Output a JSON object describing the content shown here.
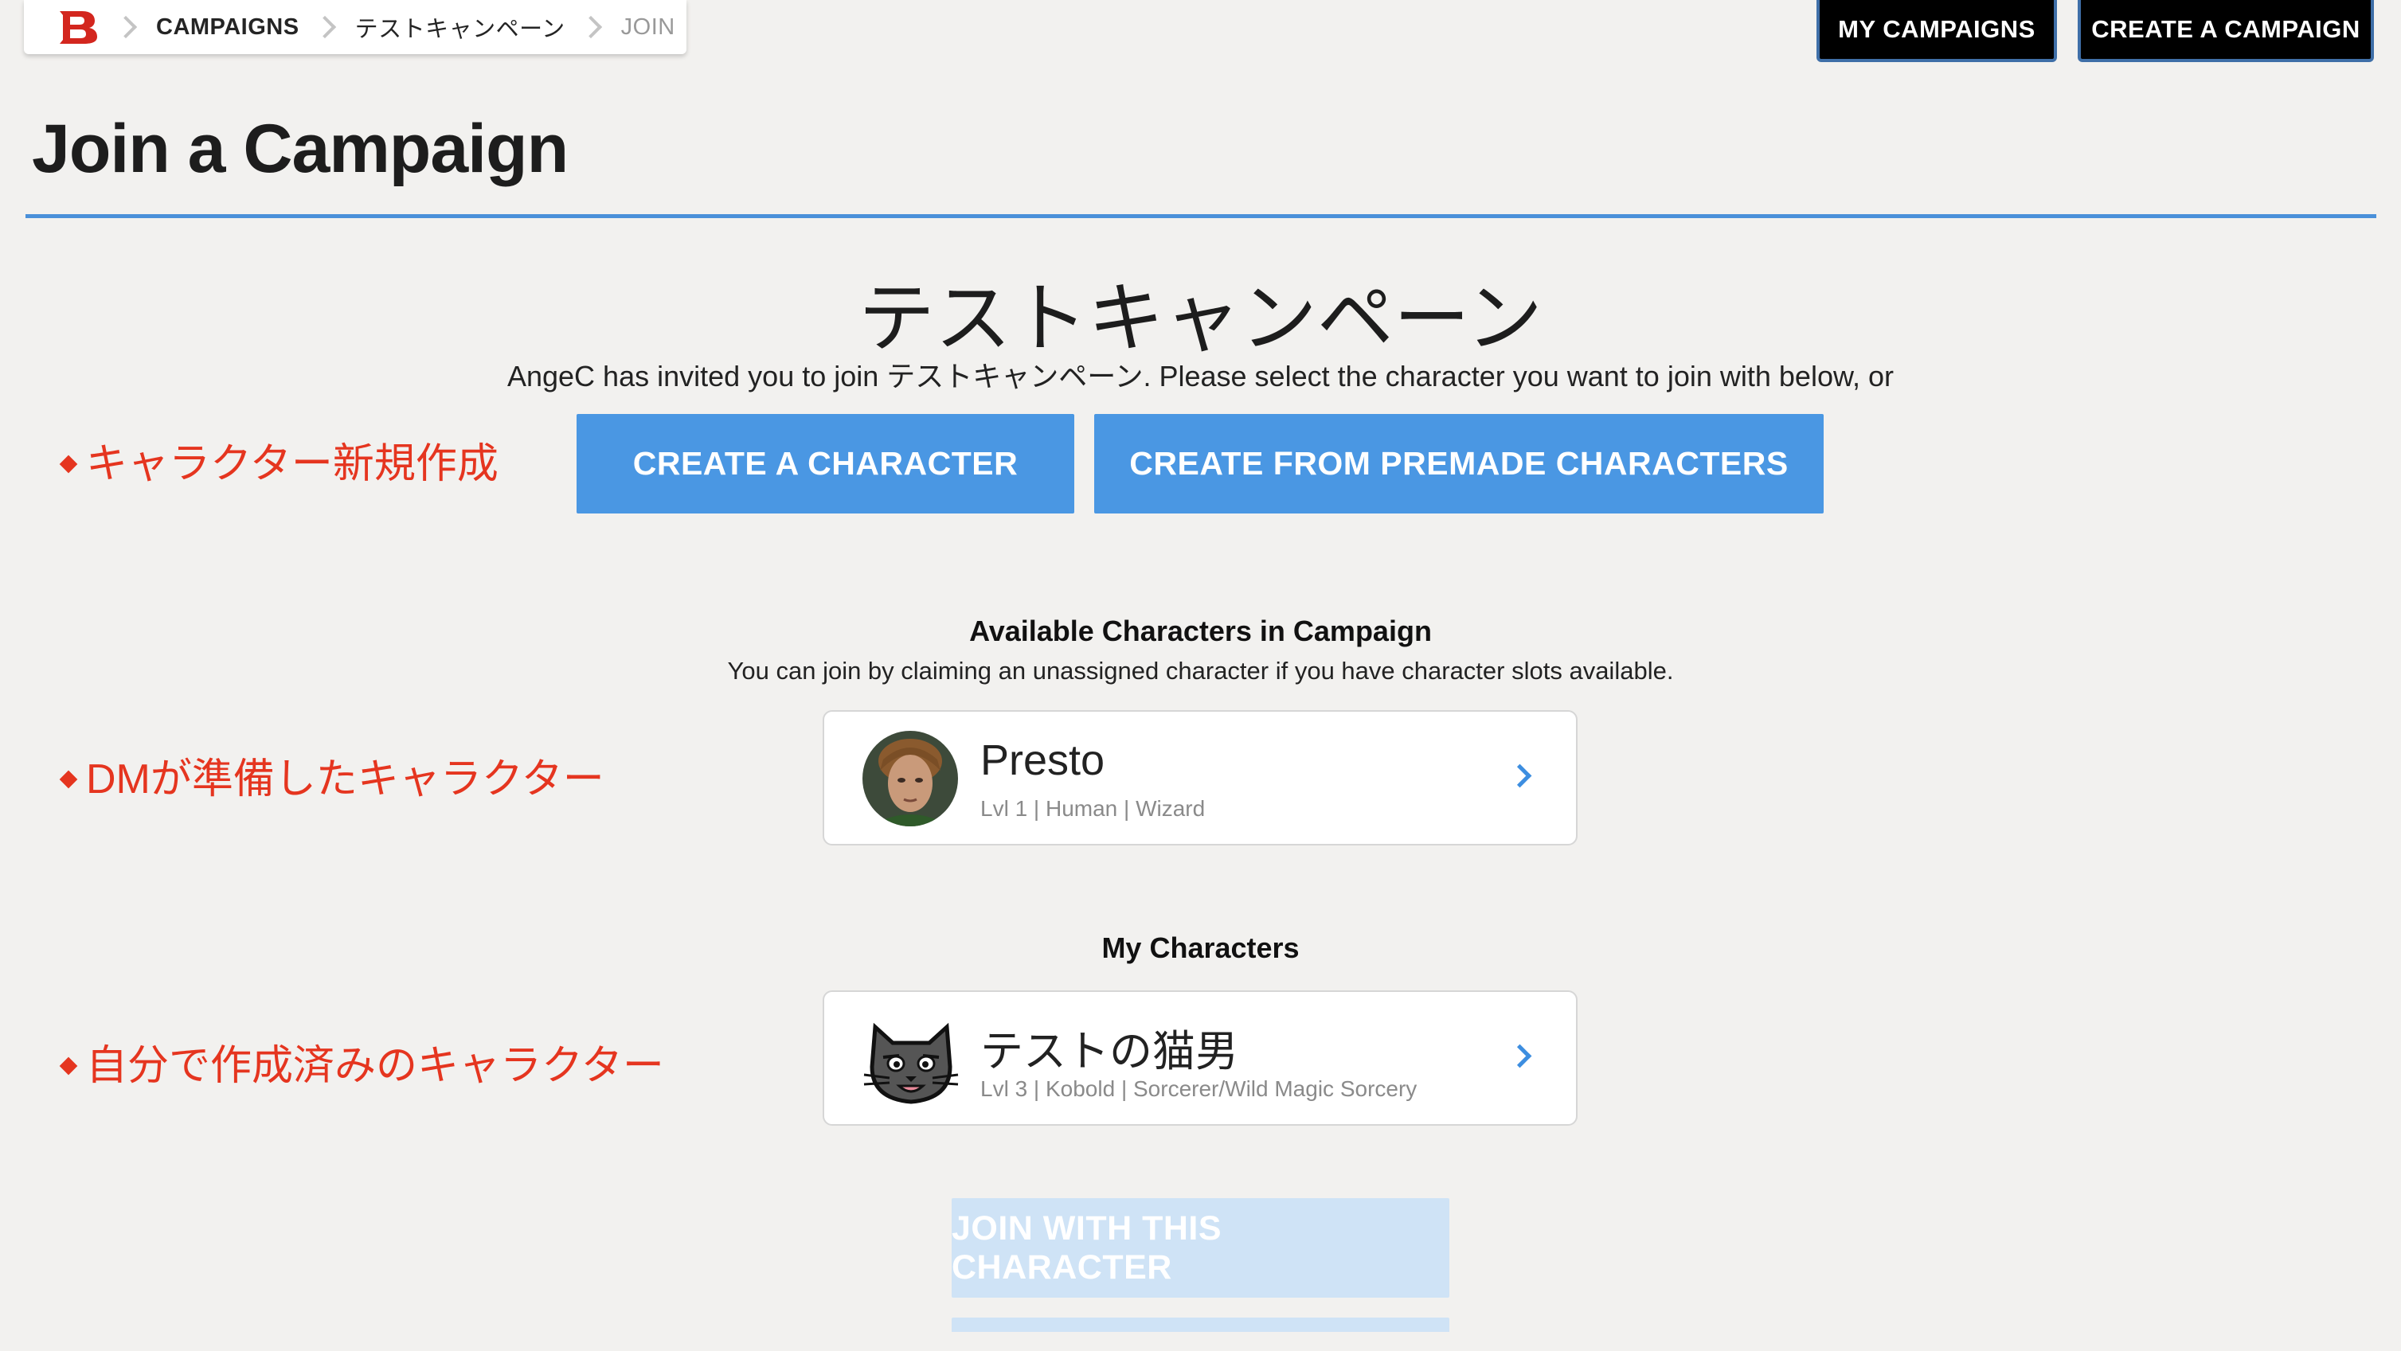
{
  "breadcrumb": {
    "logo": "B",
    "items": [
      "CAMPAIGNS",
      "テストキャンペーン",
      "JOIN"
    ]
  },
  "header_buttons": {
    "my_campaigns": "MY CAMPAIGNS",
    "create_campaign": "CREATE A CAMPAIGN"
  },
  "page": {
    "title": "Join a Campaign",
    "campaign_name": "テストキャンペーン",
    "invite_text": "AngeC has invited you to join テストキャンペーン. Please select the character you want to join with below, or"
  },
  "actions": {
    "create_character": "CREATE A CHARACTER",
    "create_premade": "CREATE FROM PREMADE CHARACTERS",
    "join_with_character": "JOIN WITH THIS CHARACTER"
  },
  "annotations": {
    "new_character": "キャラクター新規作成",
    "dm_characters": "DMが準備したキャラクター",
    "my_characters": "自分で作成済みのキャラクター"
  },
  "available": {
    "heading": "Available Characters in Campaign",
    "subtext": "You can join by claiming an unassigned character if you have character slots available.",
    "characters": [
      {
        "name": "Presto",
        "meta": "Lvl 1 | Human | Wizard"
      }
    ]
  },
  "mine": {
    "heading": "My Characters",
    "characters": [
      {
        "name": "テストの猫男",
        "meta": "Lvl 3 | Kobold | Sorcerer/Wild Magic Sorcery"
      }
    ]
  },
  "colors": {
    "accent_blue": "#4a97e3",
    "rule_blue": "#4a90d9",
    "annotation_red": "#e5351f",
    "disabled_blue": "#cfe3f6"
  },
  "icons": {
    "logo": "ddb-logo-icon",
    "separator": "chevron-right-icon",
    "card_arrow": "chevron-right-icon"
  }
}
